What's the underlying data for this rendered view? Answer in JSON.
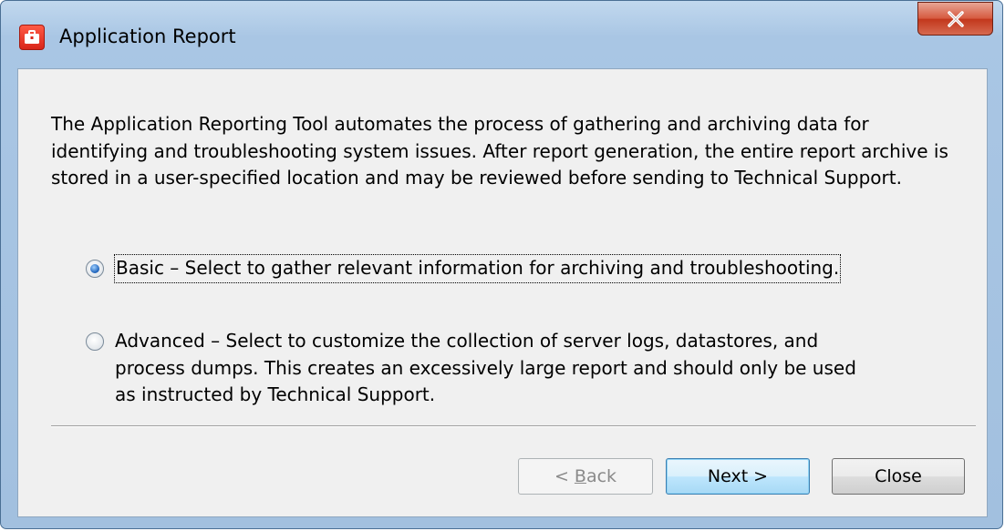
{
  "window": {
    "title": "Application Report"
  },
  "description": "The Application Reporting Tool automates the process of gathering and archiving data for identifying and troubleshooting system issues. After report generation, the entire report archive is stored in a user-specified location and may be reviewed before sending to Technical Support.",
  "options": {
    "basic": {
      "label": "Basic – Select to gather relevant information for archiving and troubleshooting.",
      "selected": true
    },
    "advanced": {
      "label": "Advanced – Select to customize the collection of server logs, datastores, and process dumps. This creates an excessively large report and should only be used as instructed by Technical Support.",
      "selected": false
    }
  },
  "buttons": {
    "back_prefix": "< ",
    "back_mnemonic": "B",
    "back_rest": "ack",
    "next": "Next >",
    "close": "Close"
  },
  "icons": {
    "app": "briefcase-icon",
    "close": "close-icon"
  },
  "colors": {
    "client_bg": "#f0f0f0",
    "close_button": "#c2361b",
    "default_button_border": "#3c7fb1"
  }
}
